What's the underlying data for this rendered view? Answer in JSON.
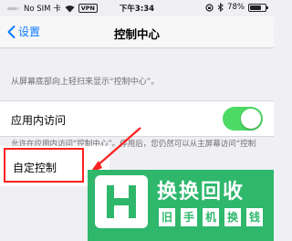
{
  "status_bar": {
    "carrier": "No SIM 卡",
    "vpn": "VPN",
    "time": "下午3:34",
    "battery": "78%",
    "battery_level": 0.78
  },
  "nav": {
    "back_label": "设置",
    "title": "控制中心"
  },
  "description": "从屏幕底部向上轻扫来显示“控制中心”。",
  "in_app_access": {
    "label": "应用内访问",
    "enabled": true
  },
  "footer": "允许在应用内访问“控制中心”。停用后，您仍然可以从主屏幕访问“控制中心”。",
  "custom_controls": {
    "label": "自定控制"
  },
  "colors": {
    "accent": "#0a7aff",
    "toggle_on": "#4cd964",
    "highlight": "#ff2020",
    "watermark_bg": "#2fb76c"
  },
  "watermark": {
    "title": "换换回收",
    "subtitle": [
      "旧",
      "手",
      "机",
      "换",
      "钱"
    ]
  }
}
